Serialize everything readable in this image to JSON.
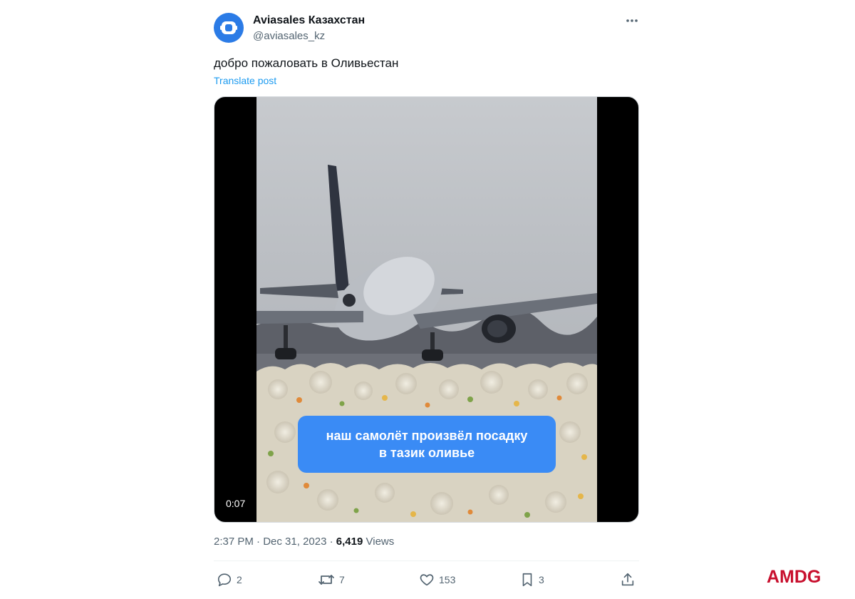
{
  "post": {
    "author_name": "Aviasales Казахстан",
    "author_handle": "@aviasales_kz",
    "text": "добро пожаловать в Оливьестан",
    "translate_label": "Translate post",
    "media": {
      "caption_line1": "наш самолёт произвёл посадку",
      "caption_line2": "в тазик оливье",
      "duration": "0:07"
    },
    "time": "2:37 PM",
    "separator": "·",
    "date": "Dec 31, 2023",
    "views_count": "6,419",
    "views_label": "Views",
    "actions": {
      "replies": "2",
      "reposts": "7",
      "likes": "153",
      "bookmarks": "3"
    }
  },
  "icons": {
    "avatar": "aviasales-logo-icon",
    "more": "more-dots-icon",
    "reply": "reply-bubble-icon",
    "repost": "repost-arrows-icon",
    "like": "heart-icon",
    "bookmark": "bookmark-icon",
    "share": "share-upload-icon"
  },
  "watermark": "AMDG",
  "colors": {
    "link": "#1d9bf0",
    "avatar": "#2b7be6",
    "caption_bubble": "#3a8bf5",
    "watermark": "#c8102e",
    "muted_text": "#536471"
  }
}
